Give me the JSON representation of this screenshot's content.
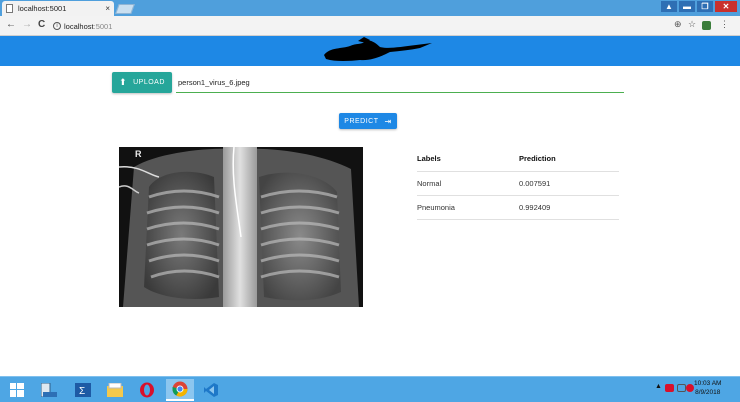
{
  "browser": {
    "tab_title": "localhost:5001",
    "tab_close": "×",
    "address_host": "localhost",
    "address_port": ":5001",
    "info_symbol": "i",
    "back_glyph": "←",
    "forward_glyph": "→",
    "reload_glyph": "C",
    "window_controls": {
      "user": "▲",
      "minimize": "▬",
      "maximize": "❐",
      "close": "✕"
    },
    "toolbar_glyphs": {
      "zoom": "⊕",
      "bookmark": "☆",
      "menu": "⋮"
    }
  },
  "header": {
    "color": "#1e88e5"
  },
  "upload": {
    "button_label": "UPLOAD",
    "icon": "upload-arrow-icon",
    "file_name": "person1_virus_6.jpeg",
    "color": "#26a69a"
  },
  "predict": {
    "button_label": "PREDICT",
    "icon": "enter-icon"
  },
  "results": {
    "headers": [
      "Labels",
      "Prediction"
    ],
    "rows": [
      {
        "label": "Normal",
        "value": "0.007591"
      },
      {
        "label": "Pneumonia",
        "value": "0.992409"
      }
    ]
  },
  "xray": {
    "marker": "R"
  },
  "taskbar": {
    "clock_time": "10:03 AM",
    "clock_date": "8/9/2018",
    "tray_caret": "▲",
    "apps": [
      "windows-start-icon",
      "file-explorer-icon",
      "powershell-icon",
      "folder-icon",
      "opera-icon",
      "chrome-icon",
      "vscode-icon"
    ]
  }
}
